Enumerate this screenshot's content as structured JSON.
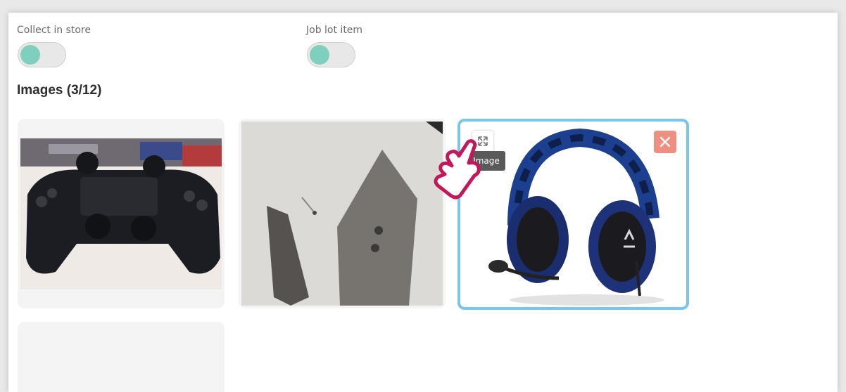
{
  "options": {
    "collect_in_store": {
      "label": "Collect in store",
      "enabled": true
    },
    "job_lot_item": {
      "label": "Job lot item",
      "enabled": true
    }
  },
  "images": {
    "title": "Images (3/12)",
    "tiles": [
      {
        "subject": "game controller photo",
        "selected": false
      },
      {
        "subject": "black plastic parts photo",
        "selected": false
      },
      {
        "subject": "camouflage gaming headset photo",
        "selected": true
      }
    ],
    "empty_slot": true
  },
  "tooltip": {
    "text": "e Image"
  },
  "icons": {
    "expand": "expand-icon",
    "remove": "close-icon",
    "cursor": "hand-pointer-icon"
  },
  "colors": {
    "toggle_knob": "#7fcfbe",
    "selected_border": "#7ac6ea",
    "remove_button": "#ef8f82",
    "cursor_outline": "#c2185b"
  }
}
